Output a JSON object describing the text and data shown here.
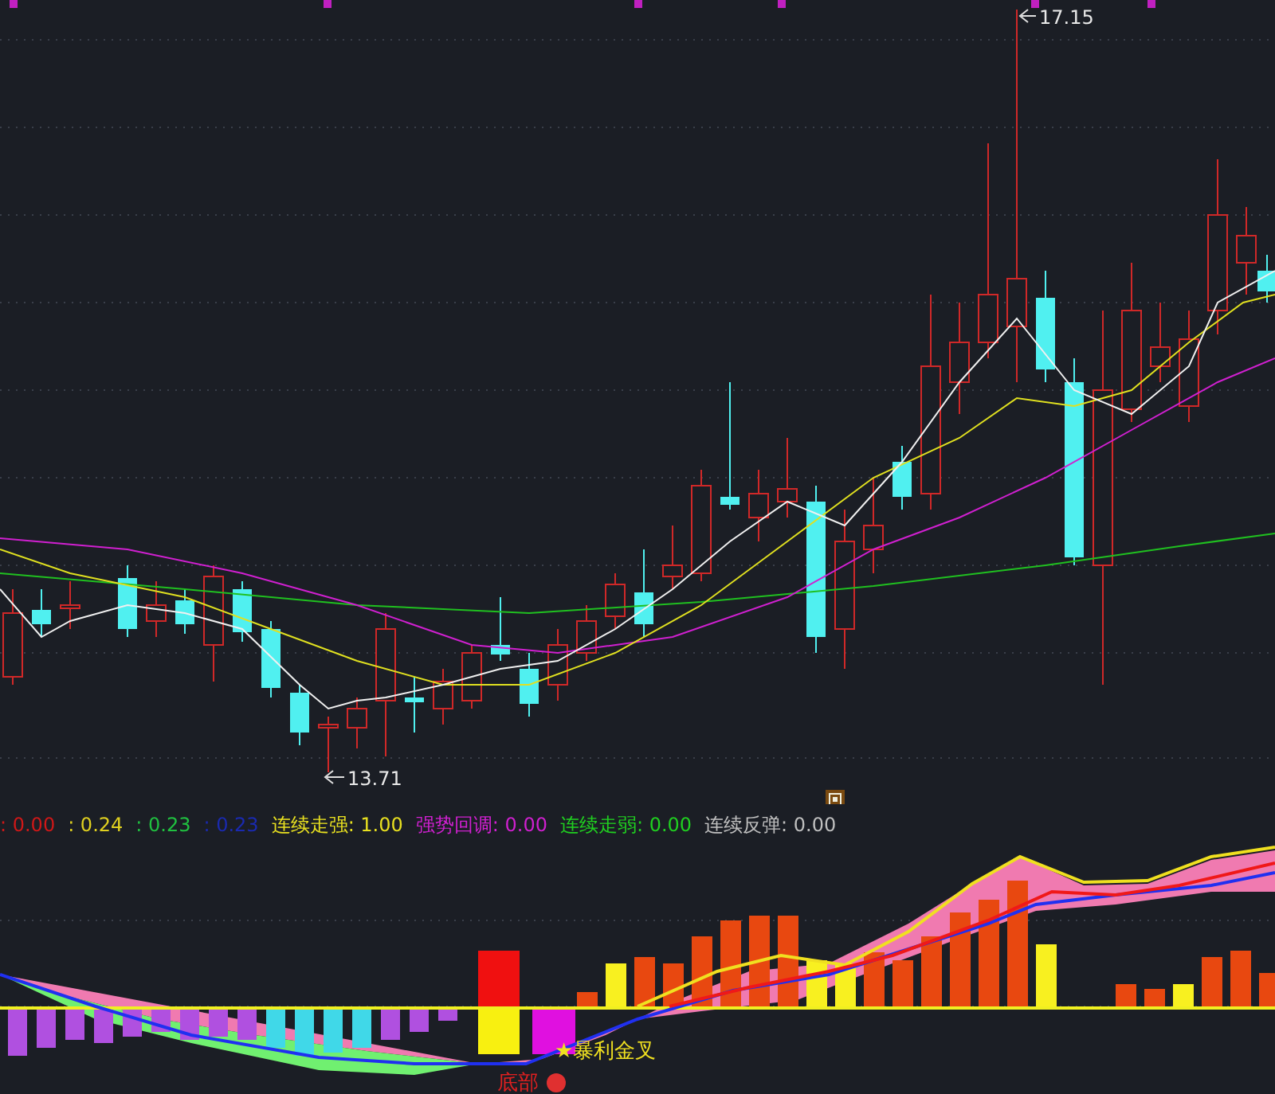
{
  "price_chart": {
    "high_label": "17.15",
    "low_label": "13.71"
  },
  "indicator_legend": [
    {
      "text": ": 0.00",
      "color": "#d01818"
    },
    {
      "text": ": 0.24",
      "color": "#e0d020"
    },
    {
      "text": ": 0.23",
      "color": "#20c040"
    },
    {
      "text": ": 0.23",
      "color": "#1a2ab0"
    },
    {
      "text": "连续走强: 1.00",
      "color": "#e8e020"
    },
    {
      "text": "强势回调: 0.00",
      "color": "#d020d0"
    },
    {
      "text": "连续走弱: 0.00",
      "color": "#20d020"
    },
    {
      "text": "连续反弹: 0.00",
      "color": "#c0c0c0"
    }
  ],
  "indicator_signals": [
    {
      "text": "底部",
      "color": "#e02020"
    },
    {
      "text": "★暴利金叉",
      "color": "#f0e020"
    }
  ]
}
